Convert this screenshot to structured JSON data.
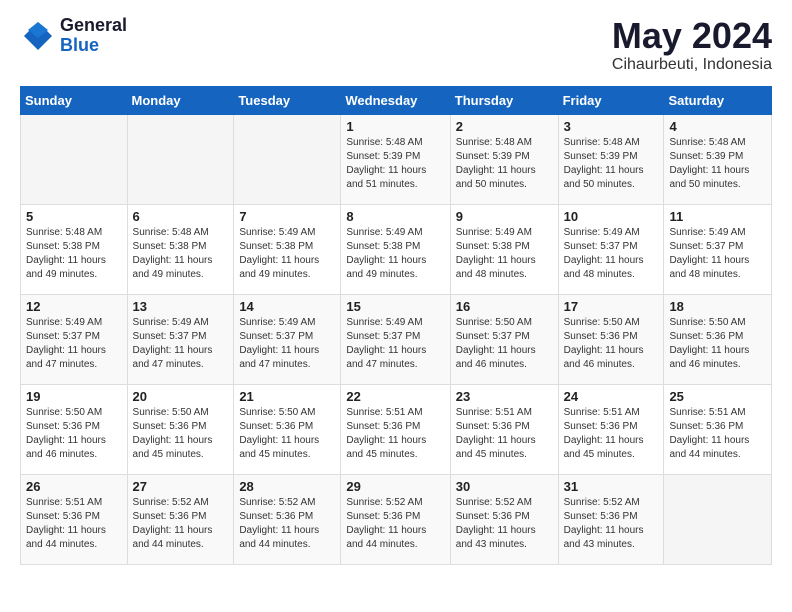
{
  "header": {
    "logo_general": "General",
    "logo_blue": "Blue",
    "month_year": "May 2024",
    "location": "Cihaurbeuti, Indonesia"
  },
  "weekdays": [
    "Sunday",
    "Monday",
    "Tuesday",
    "Wednesday",
    "Thursday",
    "Friday",
    "Saturday"
  ],
  "weeks": [
    [
      {
        "day": "",
        "info": ""
      },
      {
        "day": "",
        "info": ""
      },
      {
        "day": "",
        "info": ""
      },
      {
        "day": "1",
        "info": "Sunrise: 5:48 AM\nSunset: 5:39 PM\nDaylight: 11 hours\nand 51 minutes."
      },
      {
        "day": "2",
        "info": "Sunrise: 5:48 AM\nSunset: 5:39 PM\nDaylight: 11 hours\nand 50 minutes."
      },
      {
        "day": "3",
        "info": "Sunrise: 5:48 AM\nSunset: 5:39 PM\nDaylight: 11 hours\nand 50 minutes."
      },
      {
        "day": "4",
        "info": "Sunrise: 5:48 AM\nSunset: 5:39 PM\nDaylight: 11 hours\nand 50 minutes."
      }
    ],
    [
      {
        "day": "5",
        "info": "Sunrise: 5:48 AM\nSunset: 5:38 PM\nDaylight: 11 hours\nand 49 minutes."
      },
      {
        "day": "6",
        "info": "Sunrise: 5:48 AM\nSunset: 5:38 PM\nDaylight: 11 hours\nand 49 minutes."
      },
      {
        "day": "7",
        "info": "Sunrise: 5:49 AM\nSunset: 5:38 PM\nDaylight: 11 hours\nand 49 minutes."
      },
      {
        "day": "8",
        "info": "Sunrise: 5:49 AM\nSunset: 5:38 PM\nDaylight: 11 hours\nand 49 minutes."
      },
      {
        "day": "9",
        "info": "Sunrise: 5:49 AM\nSunset: 5:38 PM\nDaylight: 11 hours\nand 48 minutes."
      },
      {
        "day": "10",
        "info": "Sunrise: 5:49 AM\nSunset: 5:37 PM\nDaylight: 11 hours\nand 48 minutes."
      },
      {
        "day": "11",
        "info": "Sunrise: 5:49 AM\nSunset: 5:37 PM\nDaylight: 11 hours\nand 48 minutes."
      }
    ],
    [
      {
        "day": "12",
        "info": "Sunrise: 5:49 AM\nSunset: 5:37 PM\nDaylight: 11 hours\nand 47 minutes."
      },
      {
        "day": "13",
        "info": "Sunrise: 5:49 AM\nSunset: 5:37 PM\nDaylight: 11 hours\nand 47 minutes."
      },
      {
        "day": "14",
        "info": "Sunrise: 5:49 AM\nSunset: 5:37 PM\nDaylight: 11 hours\nand 47 minutes."
      },
      {
        "day": "15",
        "info": "Sunrise: 5:49 AM\nSunset: 5:37 PM\nDaylight: 11 hours\nand 47 minutes."
      },
      {
        "day": "16",
        "info": "Sunrise: 5:50 AM\nSunset: 5:37 PM\nDaylight: 11 hours\nand 46 minutes."
      },
      {
        "day": "17",
        "info": "Sunrise: 5:50 AM\nSunset: 5:36 PM\nDaylight: 11 hours\nand 46 minutes."
      },
      {
        "day": "18",
        "info": "Sunrise: 5:50 AM\nSunset: 5:36 PM\nDaylight: 11 hours\nand 46 minutes."
      }
    ],
    [
      {
        "day": "19",
        "info": "Sunrise: 5:50 AM\nSunset: 5:36 PM\nDaylight: 11 hours\nand 46 minutes."
      },
      {
        "day": "20",
        "info": "Sunrise: 5:50 AM\nSunset: 5:36 PM\nDaylight: 11 hours\nand 45 minutes."
      },
      {
        "day": "21",
        "info": "Sunrise: 5:50 AM\nSunset: 5:36 PM\nDaylight: 11 hours\nand 45 minutes."
      },
      {
        "day": "22",
        "info": "Sunrise: 5:51 AM\nSunset: 5:36 PM\nDaylight: 11 hours\nand 45 minutes."
      },
      {
        "day": "23",
        "info": "Sunrise: 5:51 AM\nSunset: 5:36 PM\nDaylight: 11 hours\nand 45 minutes."
      },
      {
        "day": "24",
        "info": "Sunrise: 5:51 AM\nSunset: 5:36 PM\nDaylight: 11 hours\nand 45 minutes."
      },
      {
        "day": "25",
        "info": "Sunrise: 5:51 AM\nSunset: 5:36 PM\nDaylight: 11 hours\nand 44 minutes."
      }
    ],
    [
      {
        "day": "26",
        "info": "Sunrise: 5:51 AM\nSunset: 5:36 PM\nDaylight: 11 hours\nand 44 minutes."
      },
      {
        "day": "27",
        "info": "Sunrise: 5:52 AM\nSunset: 5:36 PM\nDaylight: 11 hours\nand 44 minutes."
      },
      {
        "day": "28",
        "info": "Sunrise: 5:52 AM\nSunset: 5:36 PM\nDaylight: 11 hours\nand 44 minutes."
      },
      {
        "day": "29",
        "info": "Sunrise: 5:52 AM\nSunset: 5:36 PM\nDaylight: 11 hours\nand 44 minutes."
      },
      {
        "day": "30",
        "info": "Sunrise: 5:52 AM\nSunset: 5:36 PM\nDaylight: 11 hours\nand 43 minutes."
      },
      {
        "day": "31",
        "info": "Sunrise: 5:52 AM\nSunset: 5:36 PM\nDaylight: 11 hours\nand 43 minutes."
      },
      {
        "day": "",
        "info": ""
      }
    ]
  ]
}
